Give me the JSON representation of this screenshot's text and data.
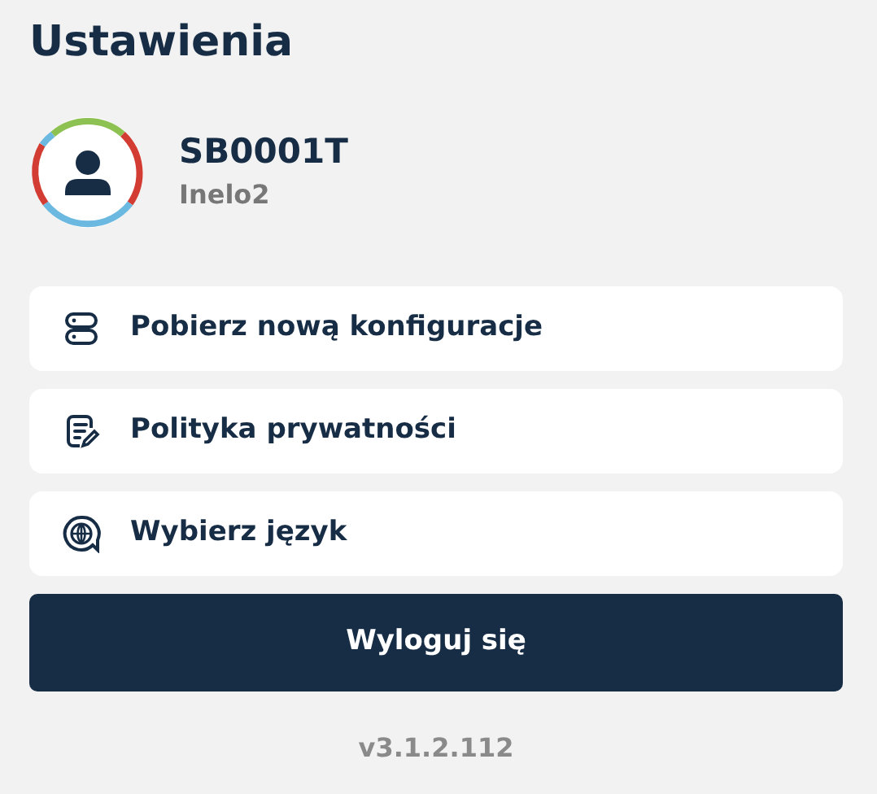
{
  "title": "Ustawienia",
  "profile": {
    "name": "SB0001T",
    "subtitle": "Inelo2"
  },
  "menu": [
    {
      "kind": "server",
      "label": "Pobierz nową konfiguracje"
    },
    {
      "kind": "document",
      "label": "Polityka prywatności"
    },
    {
      "kind": "language",
      "label": "Wybierz język"
    }
  ],
  "logout_button": "Wyloguj się",
  "version": "v3.1.2.112"
}
